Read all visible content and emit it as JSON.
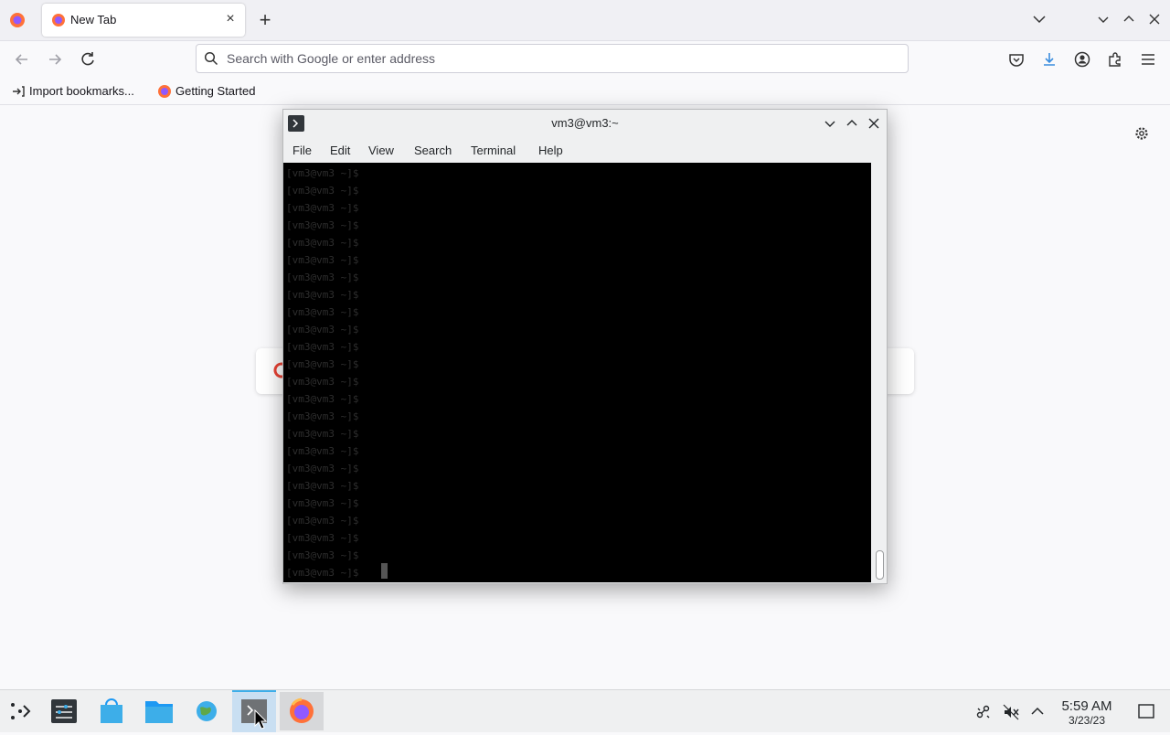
{
  "browser": {
    "tab": {
      "title": "New Tab"
    },
    "urlbar": {
      "placeholder": "Search with Google or enter address"
    },
    "bookmarks": [
      {
        "label": "Import bookmarks..."
      },
      {
        "label": "Getting Started"
      }
    ]
  },
  "terminal": {
    "title": "vm3@vm3:~",
    "menu": [
      "File",
      "Edit",
      "View",
      "Search",
      "Terminal",
      "Help"
    ],
    "lines": [
      "[vm3@vm3 ~]$",
      "[vm3@vm3 ~]$",
      "[vm3@vm3 ~]$",
      "[vm3@vm3 ~]$",
      "[vm3@vm3 ~]$",
      "[vm3@vm3 ~]$",
      "[vm3@vm3 ~]$",
      "[vm3@vm3 ~]$",
      "[vm3@vm3 ~]$",
      "[vm3@vm3 ~]$",
      "[vm3@vm3 ~]$",
      "[vm3@vm3 ~]$",
      "[vm3@vm3 ~]$",
      "[vm3@vm3 ~]$",
      "[vm3@vm3 ~]$",
      "[vm3@vm3 ~]$",
      "[vm3@vm3 ~]$",
      "[vm3@vm3 ~]$",
      "[vm3@vm3 ~]$",
      "[vm3@vm3 ~]$",
      "[vm3@vm3 ~]$",
      "[vm3@vm3 ~]$",
      "[vm3@vm3 ~]$",
      "[vm3@vm3 ~]$"
    ]
  },
  "taskbar": {
    "clock": {
      "time": "5:59 AM",
      "date": "3/23/23"
    }
  },
  "colors": {
    "accent": "#3daee9",
    "firefox_orange": "#ff7139",
    "terminal_bg": "#000000"
  }
}
